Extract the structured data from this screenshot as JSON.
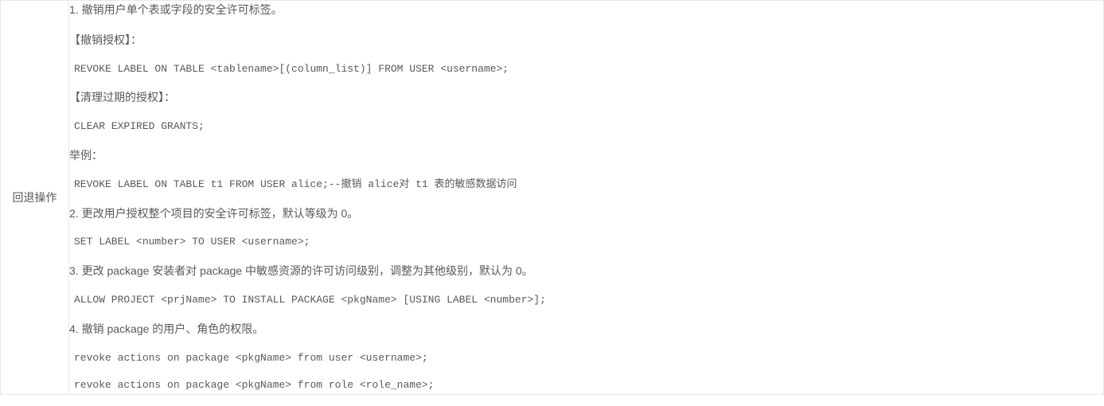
{
  "row": {
    "label": "回退操作",
    "content": {
      "p1": "1. 撤销用户单个表或字段的安全许可标签。",
      "p2": "【撤销授权】：",
      "c1": "REVOKE LABEL ON TABLE <tablename>[(column_list)] FROM USER <username>;",
      "p3": "【清理过期的授权】：",
      "c2": "CLEAR EXPIRED GRANTS;",
      "p4": "举例：",
      "c3": "REVOKE LABEL ON TABLE t1 FROM USER alice;--撤销 alice对 t1 表的敏感数据访问",
      "p5": "2. 更改用户授权整个项目的安全许可标签，默认等级为 0。",
      "c4": "SET LABEL <number> TO USER <username>;",
      "p6": "3. 更改 package 安装者对 package 中敏感资源的许可访问级别，调整为其他级别，默认为 0。",
      "c5": "ALLOW PROJECT <prjName> TO INSTALL PACKAGE <pkgName> [USING LABEL <number>];",
      "p7": "4. 撤销 package 的用户、角色的权限。",
      "c6": "revoke actions on package <pkgName> from user <username>;",
      "c7": "revoke actions on package <pkgName> from role <role_name>;"
    }
  }
}
